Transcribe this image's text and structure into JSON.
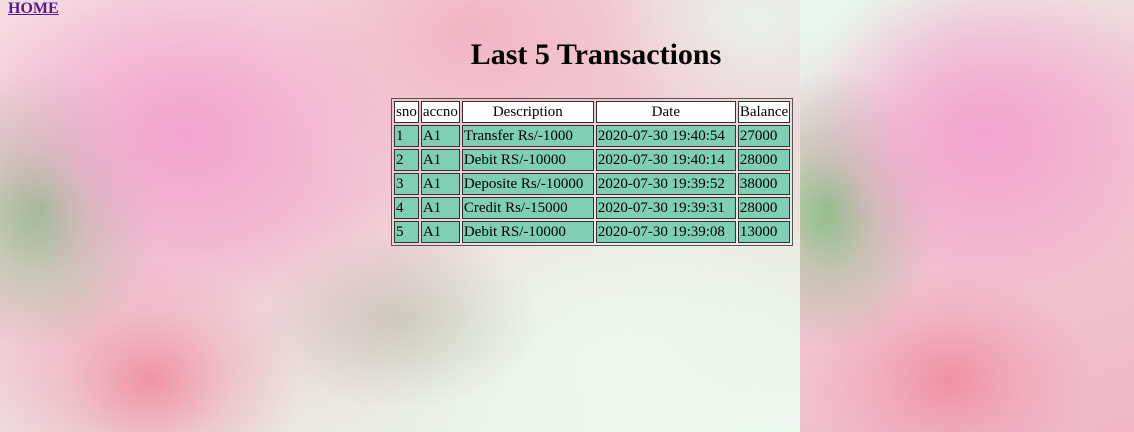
{
  "nav": {
    "home_label": "HOME"
  },
  "page": {
    "title": "Last 5 Transactions"
  },
  "table": {
    "headers": [
      "sno",
      "accno",
      "Description",
      "Date",
      "Balance"
    ],
    "rows": [
      [
        "1",
        "A1",
        "Transfer Rs/-1000",
        "2020-07-30 19:40:54",
        "27000"
      ],
      [
        "2",
        "A1",
        "Debit RS/-10000",
        "2020-07-30 19:40:14",
        "28000"
      ],
      [
        "3",
        "A1",
        "Deposite Rs/-10000",
        "2020-07-30 19:39:52",
        "38000"
      ],
      [
        "4",
        "A1",
        "Credit Rs/-15000",
        "2020-07-30 19:39:31",
        "28000"
      ],
      [
        "5",
        "A1",
        "Debit RS/-10000",
        "2020-07-30 19:39:08",
        "13000"
      ]
    ]
  },
  "colors": {
    "header_bg": "#ffffff",
    "cell_bg": "#7fcfb4",
    "link": "#551a8b"
  }
}
